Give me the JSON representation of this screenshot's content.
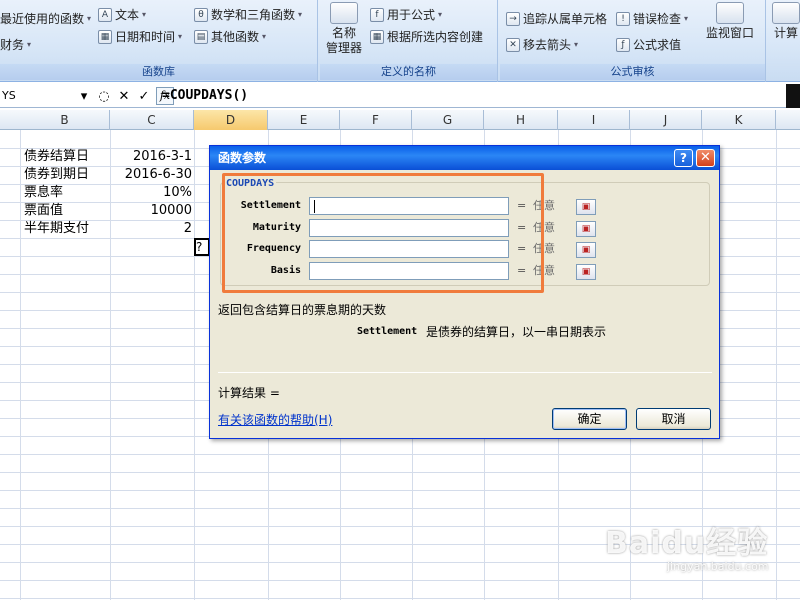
{
  "ribbon": {
    "groups": [
      {
        "label": "函数库",
        "items": [
          "最近使用的函数",
          "财务",
          "文本",
          "日期和时间",
          "数学和三角函数",
          "其他函数"
        ]
      },
      {
        "label": "定义的名称",
        "big": "名称\n管理器",
        "items": [
          "用于公式",
          "根据所选内容创建"
        ]
      },
      {
        "label": "公式审核",
        "items": [
          "追踪从属单元格",
          "错误检查",
          "移去箭头",
          "公式求值"
        ],
        "big": "监视窗口"
      },
      {
        "label": "",
        "big": "计算"
      }
    ]
  },
  "formula_bar": {
    "name_box": "YS",
    "formula": "=COUPDAYS()"
  },
  "columns": [
    "B",
    "C",
    "D",
    "E",
    "F",
    "G",
    "H",
    "I",
    "J",
    "K"
  ],
  "sheet": {
    "rows": [
      {
        "label": "债券结算日",
        "value": "2016-3-1"
      },
      {
        "label": "债券到期日",
        "value": "2016-6-30"
      },
      {
        "label": "票息率",
        "value": "10%"
      },
      {
        "label": "票面值",
        "value": "10000"
      },
      {
        "label": "半年期支付",
        "value": "2"
      }
    ],
    "active_cell_text": "?D"
  },
  "dialog": {
    "title": "函数参数",
    "function_name": "COUPDAYS",
    "args": [
      {
        "name": "Settlement",
        "value": "任意"
      },
      {
        "name": "Maturity",
        "value": "任意"
      },
      {
        "name": "Frequency",
        "value": "任意"
      },
      {
        "name": "Basis",
        "value": "任意"
      }
    ],
    "equals": "=",
    "description": "返回包含结算日的票息期的天数",
    "param_name": "Settlement",
    "param_desc": "是债券的结算日，以一串日期表示",
    "result_label": "计算结果 =",
    "help_link": "有关该函数的帮助(H)",
    "ok": "确定",
    "cancel": "取消",
    "help_icon": "?",
    "close_icon": "✕"
  },
  "watermark": {
    "brand": "Baidu经验",
    "url": "jingyan.baidu.com"
  },
  "colors": {
    "highlight": "#f07b3c",
    "titlebar": "#0a5fe8",
    "dialog_bg": "#ece9d8"
  }
}
